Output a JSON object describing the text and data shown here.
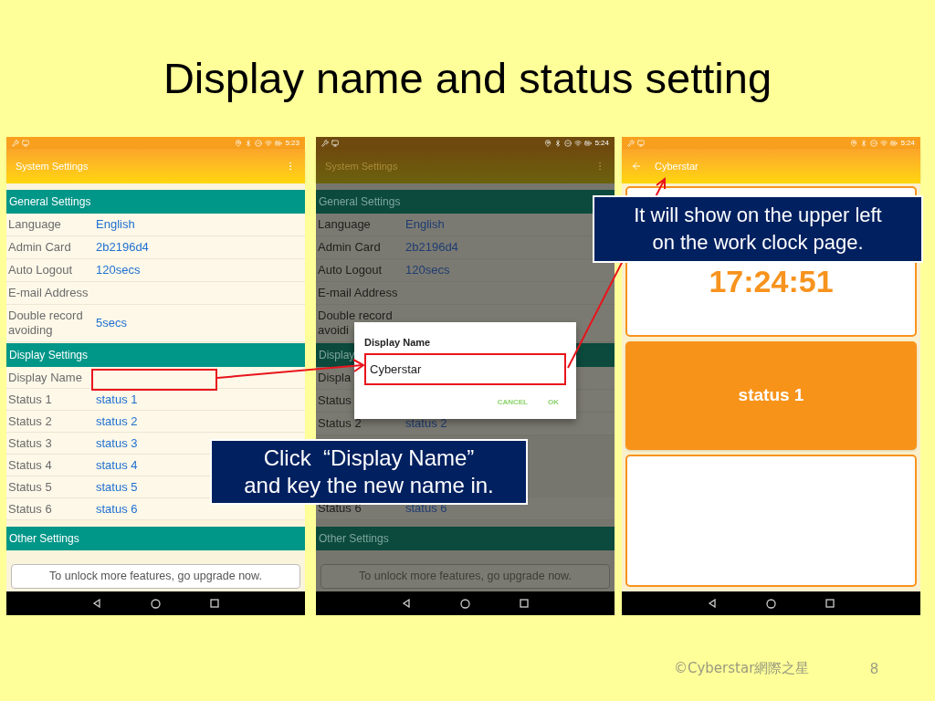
{
  "slide": {
    "title": "Display name and status setting",
    "footer": "©Cyberstar網際之星",
    "page_number": "8"
  },
  "phones": [
    {
      "kind": "settings",
      "dimmed": false,
      "status_time": "5:23",
      "app_bar": {
        "title": "System Settings",
        "back": false,
        "menu": true
      },
      "sections": [
        {
          "header": "General Settings",
          "rows": [
            {
              "label": "Language",
              "value": "English"
            },
            {
              "label": "Admin Card",
              "value": "2b2196d4"
            },
            {
              "label": "Auto Logout",
              "value": "120secs"
            },
            {
              "label": "E-mail Address"
            },
            {
              "label": "Double record avoiding",
              "value": "5secs"
            }
          ]
        },
        {
          "header": "Display Settings",
          "rows": [
            {
              "label": "Display Name"
            },
            {
              "label": "Status 1",
              "value": "status 1"
            },
            {
              "label": "Status 2",
              "value": "status 2"
            },
            {
              "label": "Status 3",
              "value": "status 3"
            },
            {
              "label": "Status 4",
              "value": "status 4"
            },
            {
              "label": "Status 5",
              "value": "status 5"
            },
            {
              "label": "Status 6",
              "value": "status 6"
            }
          ]
        },
        {
          "header": "Other Settings"
        }
      ],
      "upgrade_button": "To unlock more features, go upgrade now."
    },
    {
      "kind": "settings",
      "dimmed": true,
      "status_time": "5:24",
      "app_bar": {
        "title": "System Settings",
        "back": false,
        "menu": true
      },
      "sections": [
        {
          "header": "General Settings",
          "rows": [
            {
              "label": "Language",
              "value": "English"
            },
            {
              "label": "Admin Card",
              "value": "2b2196d4"
            },
            {
              "label": "Auto Logout",
              "value": "120secs"
            },
            {
              "label": "E-mail Address"
            },
            {
              "label": "Double record avoidi"
            }
          ]
        },
        {
          "header": "Display",
          "rows": [
            {
              "label": "Displa"
            },
            {
              "label": "Status"
            },
            {
              "label": "Status 2",
              "value": "status 2"
            },
            {
              "label": "Status 6",
              "value": "status 6"
            }
          ]
        },
        {
          "header": "Other Settings"
        }
      ],
      "upgrade_button": "To unlock more features, go upgrade now.",
      "dialog": {
        "title": "Display Name",
        "value": "Cyberstar",
        "buttons": [
          "CANCEL",
          "OK"
        ]
      }
    },
    {
      "kind": "clock",
      "dimmed": false,
      "status_time": "5:24",
      "app_bar": {
        "title": "Cyberstar",
        "back": true,
        "menu": false
      },
      "clock": "17:24:51",
      "status_button": "status 1"
    }
  ],
  "callouts": [
    {
      "lines": [
        "Click  “Display Name”",
        "and key the new name in."
      ]
    },
    {
      "lines": [
        "It will show on the upper left",
        "on the work clock page."
      ]
    }
  ]
}
